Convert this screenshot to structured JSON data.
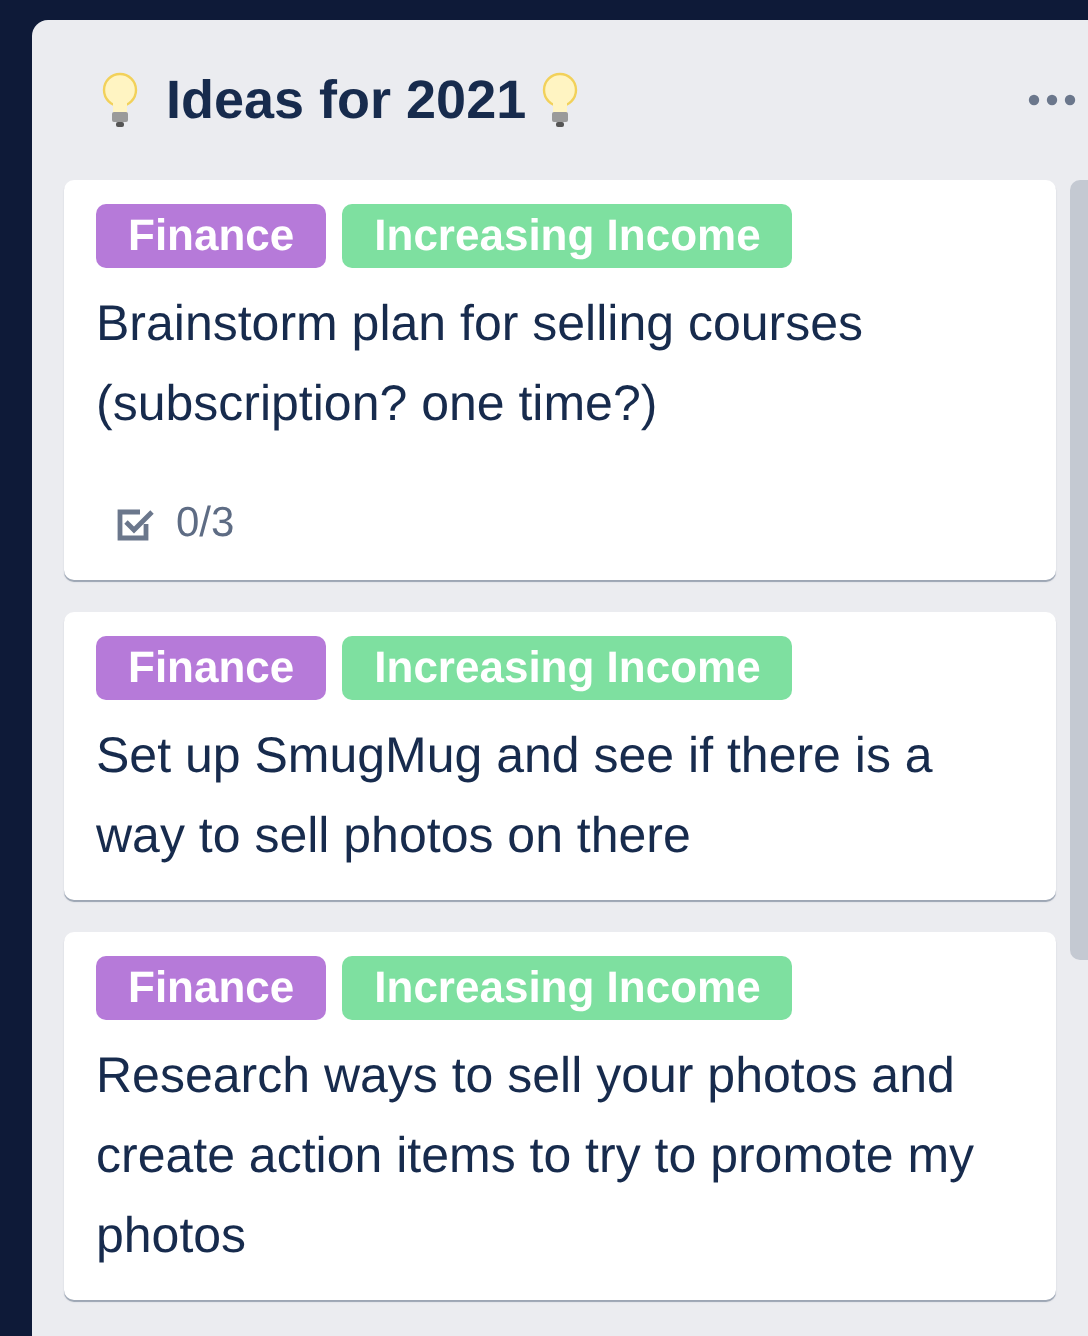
{
  "list": {
    "title": "Ideas for 2021",
    "cards": [
      {
        "labels": [
          {
            "text": "Finance",
            "color": "#b67ad9"
          },
          {
            "text": "Increasing Income",
            "color": "#7ee0a0"
          }
        ],
        "title": "Brainstorm plan for selling courses (subscription? one time?)",
        "checklist": "0/3"
      },
      {
        "labels": [
          {
            "text": "Finance",
            "color": "#b67ad9"
          },
          {
            "text": "Increasing Income",
            "color": "#7ee0a0"
          }
        ],
        "title": "Set up SmugMug and see if there is a way to sell photos on there"
      },
      {
        "labels": [
          {
            "text": "Finance",
            "color": "#b67ad9"
          },
          {
            "text": "Increasing Income",
            "color": "#7ee0a0"
          }
        ],
        "title": "Research ways to sell your photos and create action items to try to promote my photos"
      }
    ]
  }
}
